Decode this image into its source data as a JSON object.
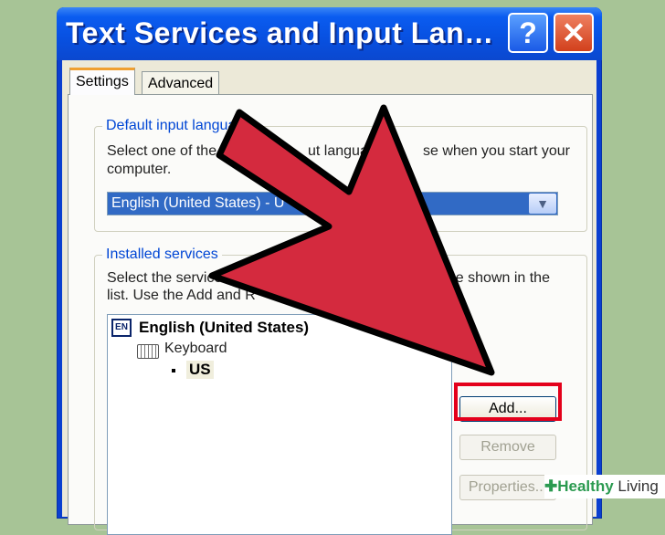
{
  "window": {
    "title": "Text Services and Input Lan…",
    "help_label": "?",
    "close_label": "✕"
  },
  "tabs": [
    "Settings",
    "Advanced"
  ],
  "default_group": {
    "label": "Default input langua",
    "desc_start": "Select one of the i",
    "desc_end": "ut language",
    "desc_end2": "se when you start your",
    "desc_line2": "computer.",
    "selected": "English (United States) - U",
    "dropdown_icon": "chevron-down-icon"
  },
  "installed_group": {
    "label": "Installed services",
    "line1_start": "Select the service",
    "line1_end": "age shown in the",
    "line2": "list. Use the Add and R",
    "tree": {
      "language": "English (United States)",
      "lang_badge": "EN",
      "category": "Keyboard",
      "layout": "US"
    }
  },
  "buttons": {
    "add": "Add...",
    "remove": "Remove",
    "properties": "Properties..."
  },
  "watermark": {
    "brand_a": "Healthy",
    "brand_b": " Living"
  },
  "colors": {
    "arrow_fill": "#d42a3e",
    "highlight": "#e4001b",
    "background": "#a7c496"
  }
}
